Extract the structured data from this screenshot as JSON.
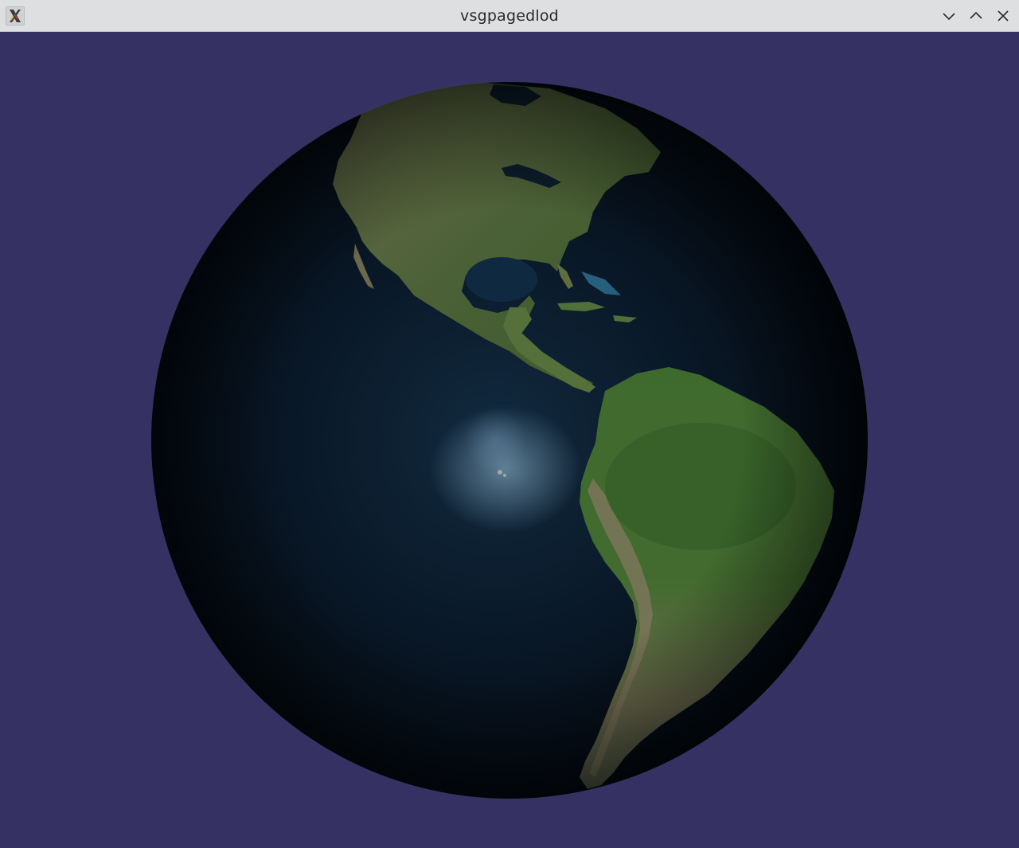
{
  "window": {
    "title": "vsgpagedlod",
    "icon": "x11-app-icon",
    "controls": [
      "minimize-icon",
      "maximize-icon",
      "close-icon"
    ]
  },
  "viewport": {
    "background_color": "#353263",
    "scene": "earth-globe-americas"
  },
  "colors": {
    "titlebar": "#dedfe1",
    "ocean": "#0a1a2a",
    "land": "#4b6036"
  }
}
